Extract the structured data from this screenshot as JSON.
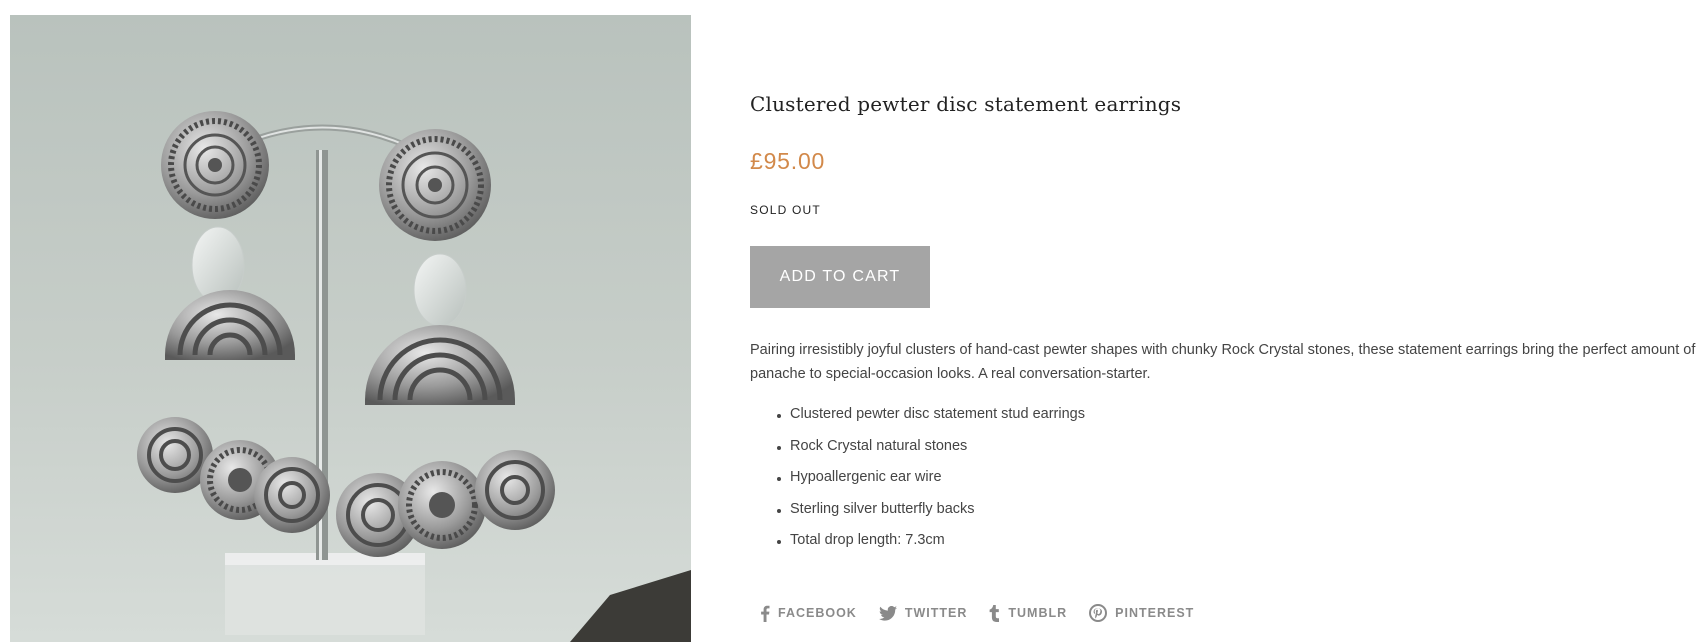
{
  "product": {
    "title": "Clustered pewter disc statement earrings",
    "price": "£95.00",
    "status": "SOLD OUT",
    "add_to_cart_label": "ADD TO CART",
    "description": "Pairing irresistibly joyful clusters of hand-cast pewter shapes with chunky Rock Crystal stones, these statement earrings bring the perfect amount of panache to special-occasion looks. A real conversation-starter.",
    "features": [
      "Clustered pewter disc statement stud earrings",
      "Rock Crystal natural stones",
      "Hypoallergenic ear wire",
      "Sterling silver butterfly backs",
      "Total drop length: 7.3cm"
    ],
    "image_subject": "pewter disc earrings on stand"
  },
  "share": [
    {
      "label": "FACEBOOK",
      "icon": "facebook-icon"
    },
    {
      "label": "TWITTER",
      "icon": "twitter-icon"
    },
    {
      "label": "TUMBLR",
      "icon": "tumblr-icon"
    },
    {
      "label": "PINTEREST",
      "icon": "pinterest-icon"
    }
  ],
  "colors": {
    "price": "#d2894a",
    "button_bg": "#a5a5a5",
    "button_text": "#ffffff",
    "share_text": "#8a8a8a",
    "body_text": "#444444"
  }
}
